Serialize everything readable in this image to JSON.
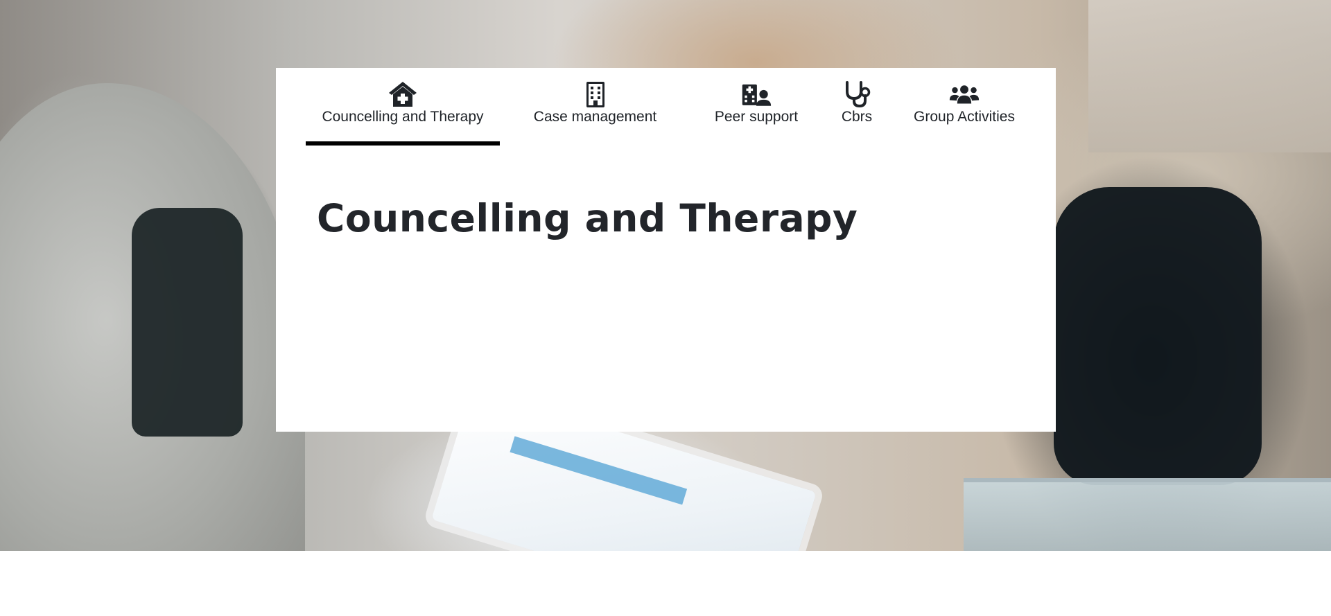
{
  "tabs": [
    {
      "label": "Councelling and Therapy",
      "icon": "house-medical-icon",
      "active": true
    },
    {
      "label": "Case management",
      "icon": "building-icon",
      "active": false
    },
    {
      "label": "Peer support",
      "icon": "hospital-user-icon",
      "active": false
    },
    {
      "label": "Cbrs",
      "icon": "stethoscope-icon",
      "active": false
    },
    {
      "label": "Group Activities",
      "icon": "users-icon",
      "active": false
    }
  ],
  "content": {
    "title": "Councelling and Therapy"
  },
  "colors": {
    "text": "#1f2328",
    "active_indicator": "#000000",
    "card_background": "#ffffff"
  }
}
